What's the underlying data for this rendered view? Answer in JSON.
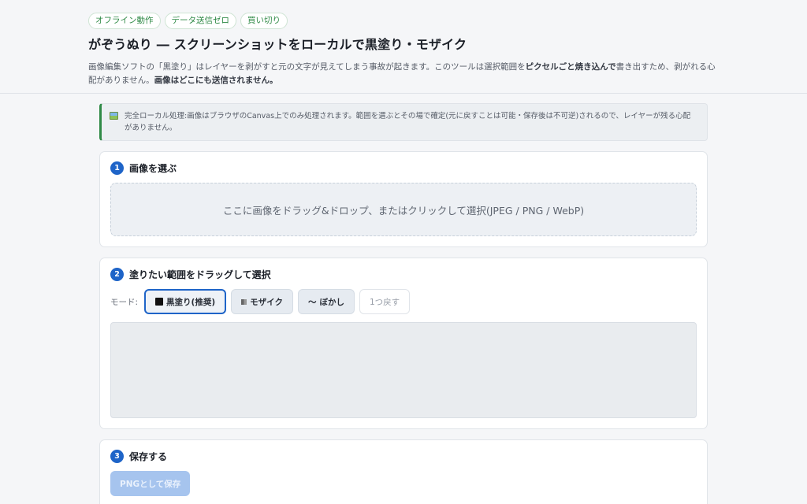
{
  "header": {
    "badges": [
      "オフライン動作",
      "データ送信ゼロ",
      "買い切り"
    ],
    "title": "がぞうぬり ― スクリーンショットをローカルで黒塗り・モザイク",
    "desc_part1": "画像編集ソフトの「黒塗り」はレイヤーを剥がすと元の文字が見えてしまう事故が起きます。このツールは選択範囲を",
    "desc_bold1": "ピクセルごと焼き込んで",
    "desc_part2": "書き出すため、剥がれる心配がありません。",
    "desc_bold2": "画像はどこにも送信されません。"
  },
  "notice": {
    "icon": "image-icon",
    "text": "完全ローカル処理:画像はブラウザのCanvas上でのみ処理されます。範囲を選ぶとその場で確定(元に戻すことは可能・保存後は不可逆)されるので、レイヤーが残る心配がありません。"
  },
  "step1": {
    "number": "1",
    "title": "画像を選ぶ",
    "dropzone_text": "ここに画像をドラッグ&ドロップ、またはクリックして選択(JPEG / PNG / WebP)"
  },
  "step2": {
    "number": "2",
    "title": "塗りたい範囲をドラッグして選択",
    "mode_label": "モード:",
    "modes": [
      {
        "label": "黒塗り(推奨)",
        "icon": "black-square-icon",
        "active": true
      },
      {
        "label": "モザイク",
        "icon": "mosaic-icon",
        "active": false
      },
      {
        "label": "ぼかし",
        "icon": "tilde-icon",
        "glyph": "〜",
        "active": false
      }
    ],
    "undo_label": "1つ戻す"
  },
  "step3": {
    "number": "3",
    "title": "保存する",
    "save_label": "PNGとして保存"
  },
  "colors": {
    "accent": "#1e64c8",
    "badge_green": "#2f8a46",
    "save_disabled": "#a6c4ee"
  }
}
